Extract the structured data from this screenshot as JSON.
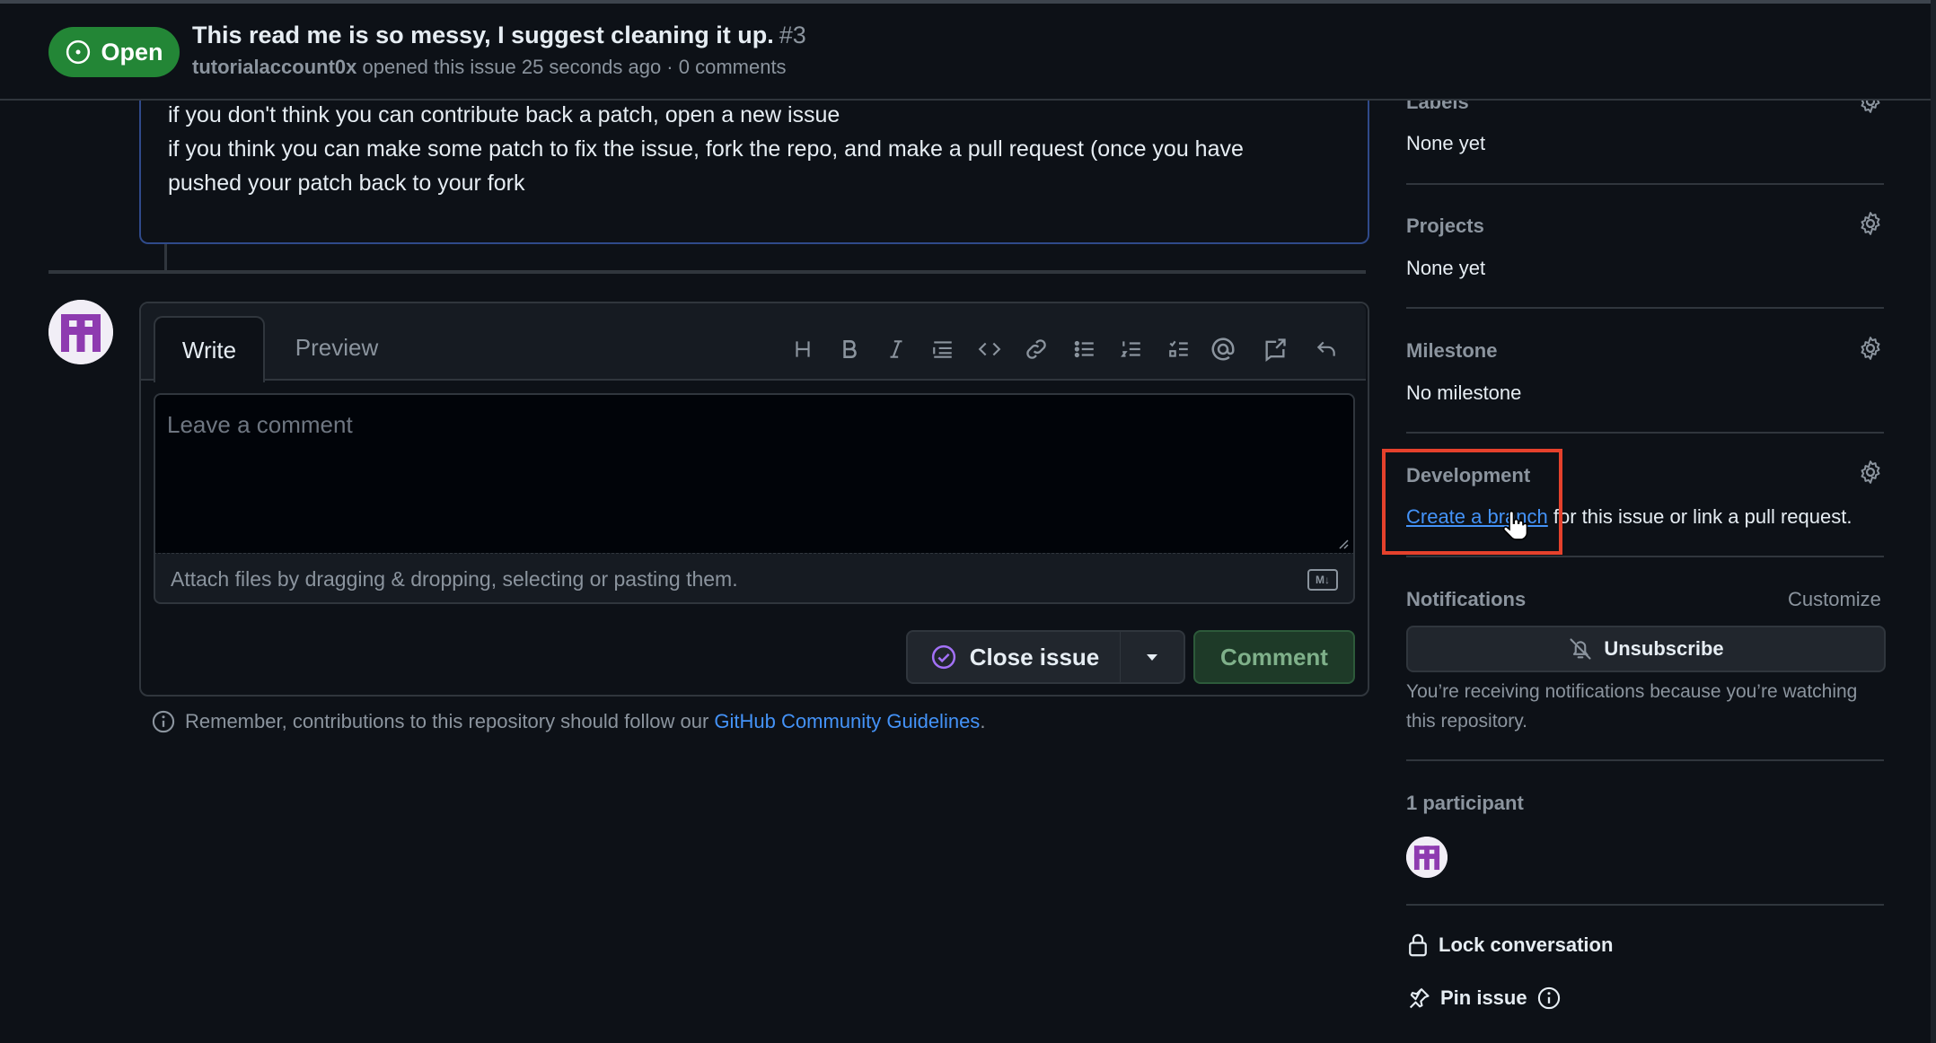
{
  "header": {
    "status": "Open",
    "title": "This read me is so messy, I suggest cleaning it up.",
    "number": "#3",
    "author": "tutorialaccount0x",
    "meta": "opened this issue 25 seconds ago · 0 comments"
  },
  "comment": {
    "lines": [
      "if you don't think you can contribute back a patch, open a new issue",
      "if you think you can make some patch to fix the issue, fork the repo, and make a pull request (once you have",
      "pushed your patch back to your fork"
    ]
  },
  "composer": {
    "tabs": [
      "Write",
      "Preview"
    ],
    "toolbar": [
      "heading-icon",
      "bold-icon",
      "italic-icon",
      "quote-icon",
      "code-icon",
      "link-icon",
      "bulleted-list-icon",
      "numbered-list-icon",
      "task-list-icon",
      "mention-icon",
      "cross-reference-icon",
      "undo-icon"
    ],
    "placeholder": "Leave a comment",
    "attach_hint": "Attach files by dragging & dropping, selecting or pasting them.",
    "markdown_badge": "M↓",
    "close_label": "Close issue",
    "comment_label": "Comment"
  },
  "reminder": {
    "text": "Remember, contributions to this repository should follow our",
    "link": "GitHub Community Guidelines",
    "suffix": "."
  },
  "sidebar": {
    "labels": {
      "title": "Labels",
      "value": "None yet"
    },
    "projects": {
      "title": "Projects",
      "value": "None yet"
    },
    "milestone": {
      "title": "Milestone",
      "value": "No milestone"
    },
    "development": {
      "title": "Development",
      "link": "Create a branch",
      "rest": " for this issue or link a pull request."
    },
    "notifications": {
      "title": "Notifications",
      "customize": "Customize",
      "unsubscribe": "Unsubscribe",
      "notice": "You’re receiving notifications because you’re watching this repository."
    },
    "participants": {
      "title": "1 participant"
    },
    "lock": "Lock conversation",
    "pin": "Pin issue"
  },
  "colors": {
    "accent_green": "#238636",
    "link_blue": "#4493f8",
    "highlight_red": "#e5412c"
  }
}
